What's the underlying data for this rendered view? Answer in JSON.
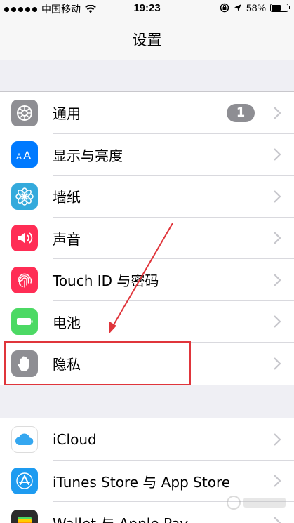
{
  "status_bar": {
    "carrier": "中国移动",
    "time": "19:23",
    "battery": "58%",
    "battery_level": 0.58
  },
  "nav": {
    "title": "设置"
  },
  "groups": [
    {
      "items": [
        {
          "label": "通用",
          "icon": "gear-icon",
          "color": "#8e8e93",
          "badge": "1"
        },
        {
          "label": "显示与亮度",
          "icon": "text-size-icon",
          "color": "#007aff"
        },
        {
          "label": "墙纸",
          "icon": "flower-icon",
          "color": "#34aadc"
        },
        {
          "label": "声音",
          "icon": "speaker-icon",
          "color": "#ff2d55"
        },
        {
          "label": "Touch ID 与密码",
          "icon": "fingerprint-icon",
          "color": "#ff2d55"
        },
        {
          "label": "电池",
          "icon": "battery-icon",
          "color": "#4cd964"
        },
        {
          "label": "隐私",
          "icon": "hand-icon",
          "color": "#8e8e93"
        }
      ]
    },
    {
      "items": [
        {
          "label": "iCloud",
          "icon": "cloud-icon",
          "color": "#ffffff"
        },
        {
          "label": "iTunes Store 与 App Store",
          "icon": "app-store-icon",
          "color": "#1e9bf0"
        },
        {
          "label": "Wallet 与 Apple Pay",
          "icon": "wallet-icon",
          "color": "#2b2b2b"
        }
      ]
    }
  ],
  "colors": {
    "highlight": "#e0353b",
    "background": "#efeff4"
  }
}
